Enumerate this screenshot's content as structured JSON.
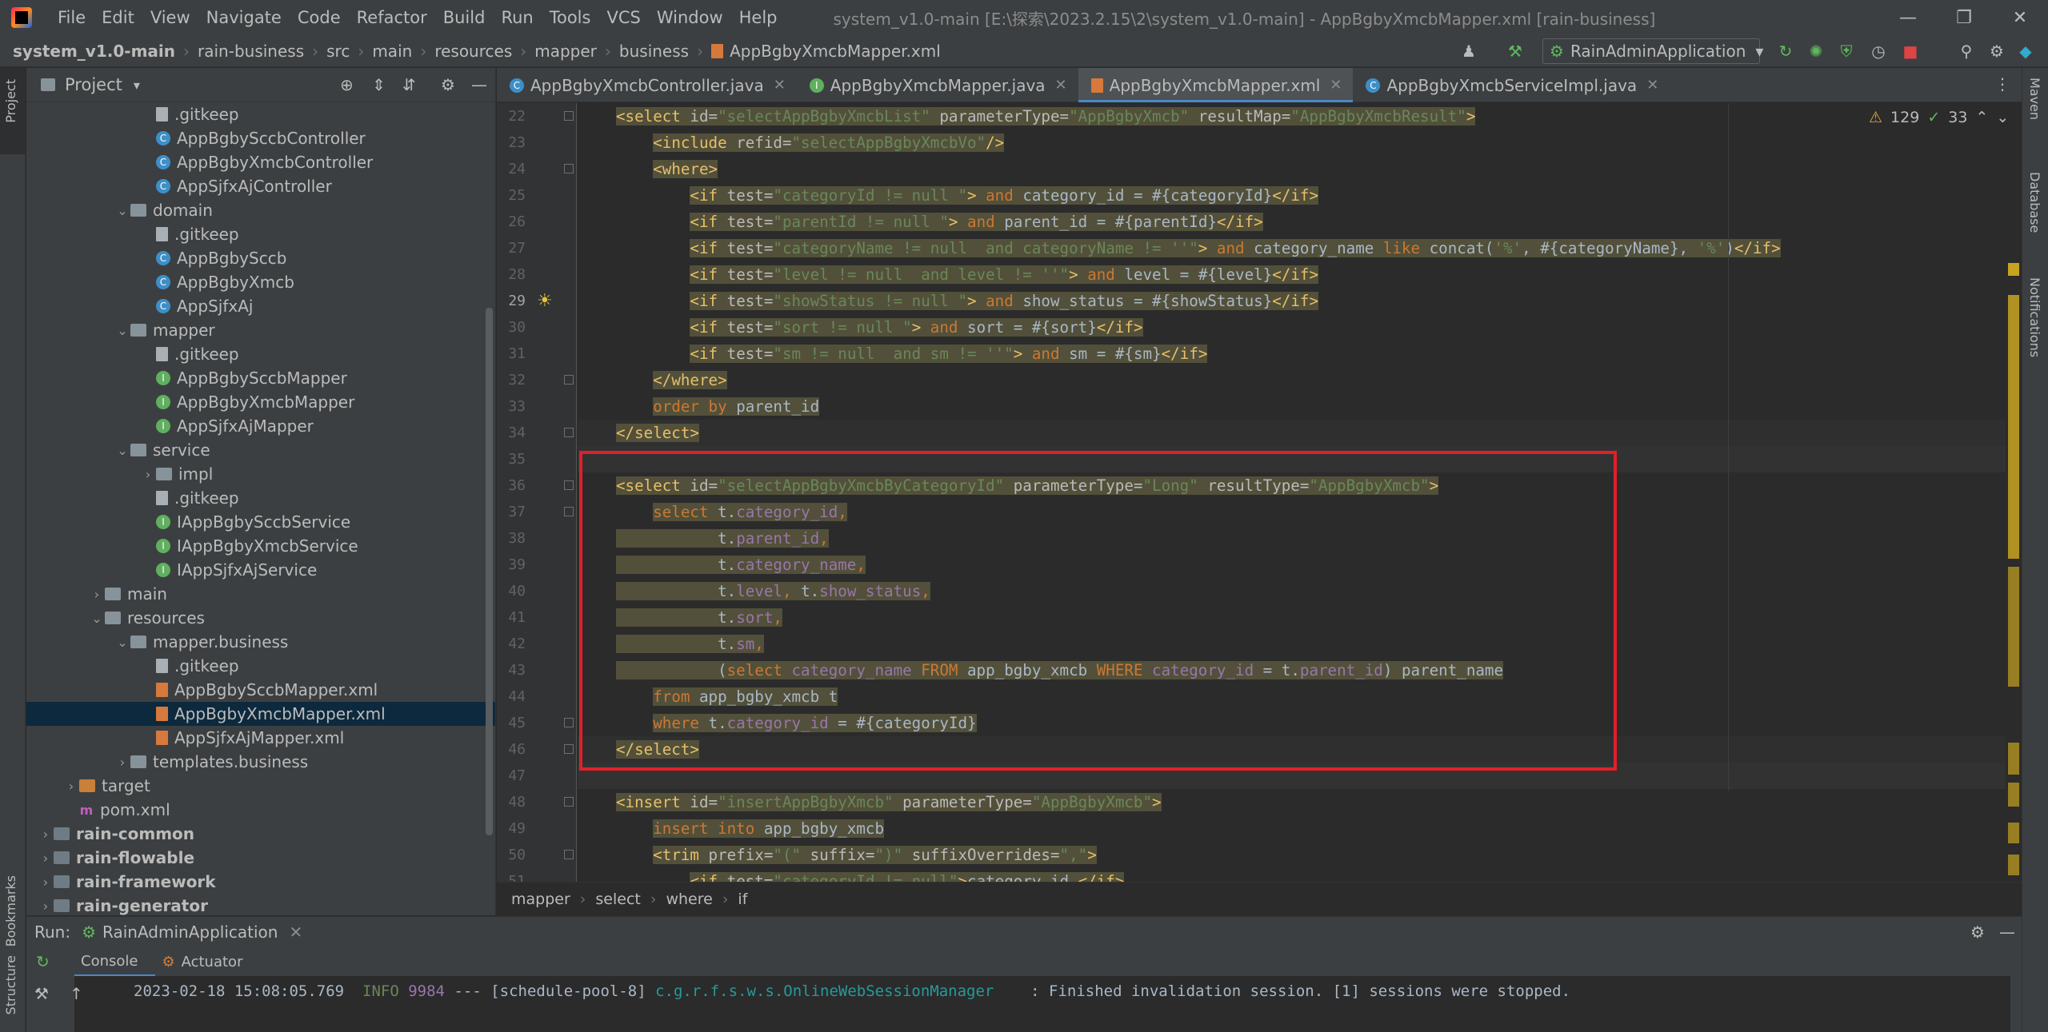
{
  "menubar": {
    "items": [
      "File",
      "Edit",
      "View",
      "Navigate",
      "Code",
      "Refactor",
      "Build",
      "Run",
      "Tools",
      "VCS",
      "Window",
      "Help"
    ],
    "window_title": "system_v1.0-main [E:\\探索\\2023.2.15\\2\\system_v1.0-main] - AppBgbyXmcbMapper.xml [rain-business]"
  },
  "breadcrumb": [
    "system_v1.0-main",
    "rain-business",
    "src",
    "main",
    "resources",
    "mapper",
    "business",
    "AppBgbyXmcbMapper.xml"
  ],
  "run_config": "RainAdminApplication",
  "project_panel": {
    "title": "Project",
    "rows": [
      {
        "label": ".gitkeep",
        "icon": "file",
        "indent": 4
      },
      {
        "label": "AppBgbySccbController",
        "icon": "class",
        "indent": 4
      },
      {
        "label": "AppBgbyXmcbController",
        "icon": "class",
        "indent": 4
      },
      {
        "label": "AppSjfxAjController",
        "icon": "class",
        "indent": 4
      },
      {
        "label": "domain",
        "icon": "folder",
        "indent": 3,
        "arrow": "open"
      },
      {
        "label": ".gitkeep",
        "icon": "file",
        "indent": 4
      },
      {
        "label": "AppBgbySccb",
        "icon": "class",
        "indent": 4
      },
      {
        "label": "AppBgbyXmcb",
        "icon": "class",
        "indent": 4
      },
      {
        "label": "AppSjfxAj",
        "icon": "class",
        "indent": 4
      },
      {
        "label": "mapper",
        "icon": "folder",
        "indent": 3,
        "arrow": "open"
      },
      {
        "label": ".gitkeep",
        "icon": "file",
        "indent": 4
      },
      {
        "label": "AppBgbySccbMapper",
        "icon": "iface",
        "indent": 4
      },
      {
        "label": "AppBgbyXmcbMapper",
        "icon": "iface",
        "indent": 4
      },
      {
        "label": "AppSjfxAjMapper",
        "icon": "iface",
        "indent": 4
      },
      {
        "label": "service",
        "icon": "folder",
        "indent": 3,
        "arrow": "open"
      },
      {
        "label": "impl",
        "icon": "folder",
        "indent": 4,
        "arrow": "closed"
      },
      {
        "label": ".gitkeep",
        "icon": "file",
        "indent": 4
      },
      {
        "label": "IAppBgbySccbService",
        "icon": "iface",
        "indent": 4
      },
      {
        "label": "IAppBgbyXmcbService",
        "icon": "iface",
        "indent": 4
      },
      {
        "label": "IAppSjfxAjService",
        "icon": "iface",
        "indent": 4
      },
      {
        "label": "main",
        "icon": "folder",
        "indent": 2,
        "arrow": "closed"
      },
      {
        "label": "resources",
        "icon": "folder",
        "indent": 2,
        "arrow": "open"
      },
      {
        "label": "mapper.business",
        "icon": "folder",
        "indent": 3,
        "arrow": "open"
      },
      {
        "label": ".gitkeep",
        "icon": "file",
        "indent": 4
      },
      {
        "label": "AppBgbySccbMapper.xml",
        "icon": "xml",
        "indent": 4
      },
      {
        "label": "AppBgbyXmcbMapper.xml",
        "icon": "xml",
        "indent": 4,
        "selected": true
      },
      {
        "label": "AppSjfxAjMapper.xml",
        "icon": "xml",
        "indent": 4
      },
      {
        "label": "templates.business",
        "icon": "folder",
        "indent": 3,
        "arrow": "closed"
      },
      {
        "label": "target",
        "icon": "folder-orange",
        "indent": 1,
        "arrow": "closed"
      },
      {
        "label": "pom.xml",
        "icon": "maven",
        "indent": 1
      },
      {
        "label": "rain-common",
        "icon": "module",
        "indent": 0,
        "arrow": "closed",
        "bold": true
      },
      {
        "label": "rain-flowable",
        "icon": "module",
        "indent": 0,
        "arrow": "closed",
        "bold": true
      },
      {
        "label": "rain-framework",
        "icon": "module",
        "indent": 0,
        "arrow": "closed",
        "bold": true
      },
      {
        "label": "rain-generator",
        "icon": "module",
        "indent": 0,
        "arrow": "closed",
        "bold": true
      }
    ]
  },
  "editor_tabs": [
    {
      "label": "AppBgbyXmcbController.java",
      "icon": "class"
    },
    {
      "label": "AppBgbyXmcbMapper.java",
      "icon": "iface"
    },
    {
      "label": "AppBgbyXmcbMapper.xml",
      "icon": "xml",
      "active": true
    },
    {
      "label": "AppBgbyXmcbServiceImpl.java",
      "icon": "class"
    }
  ],
  "inspections": {
    "warnings": "129",
    "weak_warnings": "33"
  },
  "code": {
    "first_line": 22,
    "current_line": 29,
    "lines": [
      [
        [
          "t-tag",
          "<select "
        ],
        [
          "t-attr",
          "id="
        ],
        [
          "t-val",
          "\"selectAppBgbyXmcbList\""
        ],
        [
          "t-attr",
          " parameterType="
        ],
        [
          "t-val",
          "\"AppBgbyXmcb\""
        ],
        [
          "t-attr",
          " resultMap="
        ],
        [
          "t-val",
          "\"AppBgbyXmcbResult\""
        ],
        [
          "t-tag",
          ">"
        ]
      ],
      [
        [
          "t-txt",
          "    "
        ],
        [
          "t-tag",
          "<include "
        ],
        [
          "t-attr",
          "refid="
        ],
        [
          "t-val",
          "\"selectAppBgbyXmcbVo\""
        ],
        [
          "t-tag",
          "/>"
        ]
      ],
      [
        [
          "t-txt",
          "    "
        ],
        [
          "t-tag",
          "<where>"
        ]
      ],
      [
        [
          "t-txt",
          "        "
        ],
        [
          "t-tag",
          "<if "
        ],
        [
          "t-attr",
          "test="
        ],
        [
          "t-val",
          "\"categoryId != null \""
        ],
        [
          "t-tag",
          ">"
        ],
        [
          "t-kw",
          " and "
        ],
        [
          "t-txt",
          "category_id = #{categoryId}"
        ],
        [
          "t-tag",
          "</if>"
        ]
      ],
      [
        [
          "t-txt",
          "        "
        ],
        [
          "t-tag",
          "<if "
        ],
        [
          "t-attr",
          "test="
        ],
        [
          "t-val",
          "\"parentId != null \""
        ],
        [
          "t-tag",
          ">"
        ],
        [
          "t-kw",
          " and "
        ],
        [
          "t-txt",
          "parent_id = #{parentId}"
        ],
        [
          "t-tag",
          "</if>"
        ]
      ],
      [
        [
          "t-txt",
          "        "
        ],
        [
          "t-tag",
          "<if "
        ],
        [
          "t-attr",
          "test="
        ],
        [
          "t-val",
          "\"categoryName != null  and categoryName != ''\""
        ],
        [
          "t-tag",
          ">"
        ],
        [
          "t-kw",
          " and "
        ],
        [
          "t-txt",
          "category_name "
        ],
        [
          "t-kw",
          "like "
        ],
        [
          "t-txt",
          "concat("
        ],
        [
          "t-str",
          "'%'"
        ],
        [
          "t-txt",
          ", #{categoryName}, "
        ],
        [
          "t-str",
          "'%'"
        ],
        [
          "t-txt",
          ")"
        ],
        [
          "t-tag",
          "</if>"
        ]
      ],
      [
        [
          "t-txt",
          "        "
        ],
        [
          "t-tag",
          "<if "
        ],
        [
          "t-attr",
          "test="
        ],
        [
          "t-val",
          "\"level != null  and level != ''\""
        ],
        [
          "t-tag",
          ">"
        ],
        [
          "t-kw",
          " and "
        ],
        [
          "t-txt",
          "level = #{level}"
        ],
        [
          "t-tag",
          "</if>"
        ]
      ],
      [
        [
          "t-txt",
          "        "
        ],
        [
          "t-tag",
          "<if "
        ],
        [
          "t-attr",
          "test="
        ],
        [
          "t-val",
          "\"showStatus != null \""
        ],
        [
          "t-tag",
          ">"
        ],
        [
          "t-kw",
          " and "
        ],
        [
          "t-txt",
          "show_status = #{showStatus}"
        ],
        [
          "t-tag",
          "</if>"
        ]
      ],
      [
        [
          "t-txt",
          "        "
        ],
        [
          "t-tag",
          "<if "
        ],
        [
          "t-attr",
          "test="
        ],
        [
          "t-val",
          "\"sort != null \""
        ],
        [
          "t-tag",
          ">"
        ],
        [
          "t-kw",
          " and "
        ],
        [
          "t-txt",
          "sort = #{sort}"
        ],
        [
          "t-tag",
          "</if>"
        ]
      ],
      [
        [
          "t-txt",
          "        "
        ],
        [
          "t-tag",
          "<if "
        ],
        [
          "t-attr",
          "test="
        ],
        [
          "t-val",
          "\"sm != null  and sm != ''\""
        ],
        [
          "t-tag",
          ">"
        ],
        [
          "t-kw",
          " and "
        ],
        [
          "t-txt",
          "sm = #{sm}"
        ],
        [
          "t-tag",
          "</if>"
        ]
      ],
      [
        [
          "t-txt",
          "    "
        ],
        [
          "t-tag",
          "</where>"
        ]
      ],
      [
        [
          "t-txt",
          "    "
        ],
        [
          "t-kw",
          "order by "
        ],
        [
          "t-txt",
          "parent_id"
        ]
      ],
      [
        [
          "t-tag",
          "</select>"
        ]
      ],
      [],
      [
        [
          "t-tag",
          "<select "
        ],
        [
          "t-attr",
          "id="
        ],
        [
          "t-val",
          "\"selectAppBgbyXmcbByCategoryId\""
        ],
        [
          "t-attr",
          " parameterType="
        ],
        [
          "t-val",
          "\"Long\""
        ],
        [
          "t-attr",
          " resultType="
        ],
        [
          "t-val",
          "\"AppBgbyXmcb\""
        ],
        [
          "t-tag",
          ">"
        ]
      ],
      [
        [
          "t-txt",
          "    "
        ],
        [
          "t-kw",
          "select "
        ],
        [
          "t-txt",
          "t."
        ],
        [
          "t-pur",
          "category_id"
        ],
        [
          "t-kw",
          ","
        ]
      ],
      [
        [
          "t-txt",
          "           t."
        ],
        [
          "t-pur",
          "parent_id"
        ],
        [
          "t-kw",
          ","
        ]
      ],
      [
        [
          "t-txt",
          "           t."
        ],
        [
          "t-pur",
          "category_name"
        ],
        [
          "t-kw",
          ","
        ]
      ],
      [
        [
          "t-txt",
          "           t."
        ],
        [
          "t-pur",
          "level"
        ],
        [
          "t-kw",
          ", "
        ],
        [
          "t-txt",
          "t."
        ],
        [
          "t-pur",
          "show_status"
        ],
        [
          "t-kw",
          ","
        ]
      ],
      [
        [
          "t-txt",
          "           t."
        ],
        [
          "t-pur",
          "sort"
        ],
        [
          "t-kw",
          ","
        ]
      ],
      [
        [
          "t-txt",
          "           t."
        ],
        [
          "t-pur",
          "sm"
        ],
        [
          "t-kw",
          ","
        ]
      ],
      [
        [
          "t-txt",
          "           ("
        ],
        [
          "t-kw",
          "select "
        ],
        [
          "t-pur",
          "category_name "
        ],
        [
          "t-kw",
          "FROM "
        ],
        [
          "t-txt",
          "app_bgby_xmcb "
        ],
        [
          "t-kw",
          "WHERE "
        ],
        [
          "t-pur",
          "category_id "
        ],
        [
          "t-txt",
          "= t."
        ],
        [
          "t-pur",
          "parent_id"
        ],
        [
          "t-txt",
          ") parent_name"
        ]
      ],
      [
        [
          "t-txt",
          "    "
        ],
        [
          "t-kw",
          "from "
        ],
        [
          "t-txt",
          "app_bgby_xmcb t"
        ]
      ],
      [
        [
          "t-txt",
          "    "
        ],
        [
          "t-kw",
          "where "
        ],
        [
          "t-txt",
          "t."
        ],
        [
          "t-pur",
          "category_id "
        ],
        [
          "t-txt",
          "= #{categoryId}"
        ]
      ],
      [
        [
          "t-tag",
          "</select>"
        ]
      ],
      [],
      [
        [
          "t-tag",
          "<insert "
        ],
        [
          "t-attr",
          "id="
        ],
        [
          "t-val",
          "\"insertAppBgbyXmcb\""
        ],
        [
          "t-attr",
          " parameterType="
        ],
        [
          "t-val",
          "\"AppBgbyXmcb\""
        ],
        [
          "t-tag",
          ">"
        ]
      ],
      [
        [
          "t-txt",
          "    "
        ],
        [
          "t-kw",
          "insert into "
        ],
        [
          "t-txt",
          "app_bgby_xmcb"
        ]
      ],
      [
        [
          "t-txt",
          "    "
        ],
        [
          "t-tag",
          "<trim "
        ],
        [
          "t-attr",
          "prefix="
        ],
        [
          "t-val",
          "\"(\""
        ],
        [
          "t-attr",
          " suffix="
        ],
        [
          "t-val",
          "\")\""
        ],
        [
          "t-attr",
          " suffixOverrides="
        ],
        [
          "t-val",
          "\",\""
        ],
        [
          "t-tag",
          ">"
        ]
      ],
      [
        [
          "t-txt",
          "        "
        ],
        [
          "t-tag",
          "<if "
        ],
        [
          "t-attr",
          "test="
        ],
        [
          "t-val",
          "\"categoryId != null\""
        ],
        [
          "t-tag",
          ">"
        ],
        [
          "t-txt",
          "category_id,"
        ],
        [
          "t-tag",
          "</if>"
        ]
      ]
    ]
  },
  "editor_breadcrumb": [
    "mapper",
    "select",
    "where",
    "if"
  ],
  "run_panel": {
    "label": "Run:",
    "config": "RainAdminApplication",
    "tabs": [
      "Console",
      "Actuator"
    ],
    "log": {
      "timestamp": "2023-02-18 15:08:05.769",
      "level": "INFO",
      "pid": "9984",
      "thread": "--- [schedule-pool-8]",
      "logger": "c.g.r.f.s.w.s.OnlineWebSessionManager",
      "message": "   : Finished invalidation session. [1] sessions were stopped."
    }
  },
  "side_tabs": {
    "left_top": "Project",
    "left_bottom": [
      "Bookmarks",
      "Structure"
    ],
    "right": [
      "Maven",
      "Database",
      "Notifications"
    ]
  },
  "colors": {
    "accent": "#4a88c7",
    "highlight_box": "#e0202a",
    "bg": "#2b2b2b",
    "panel": "#3c3f41"
  }
}
